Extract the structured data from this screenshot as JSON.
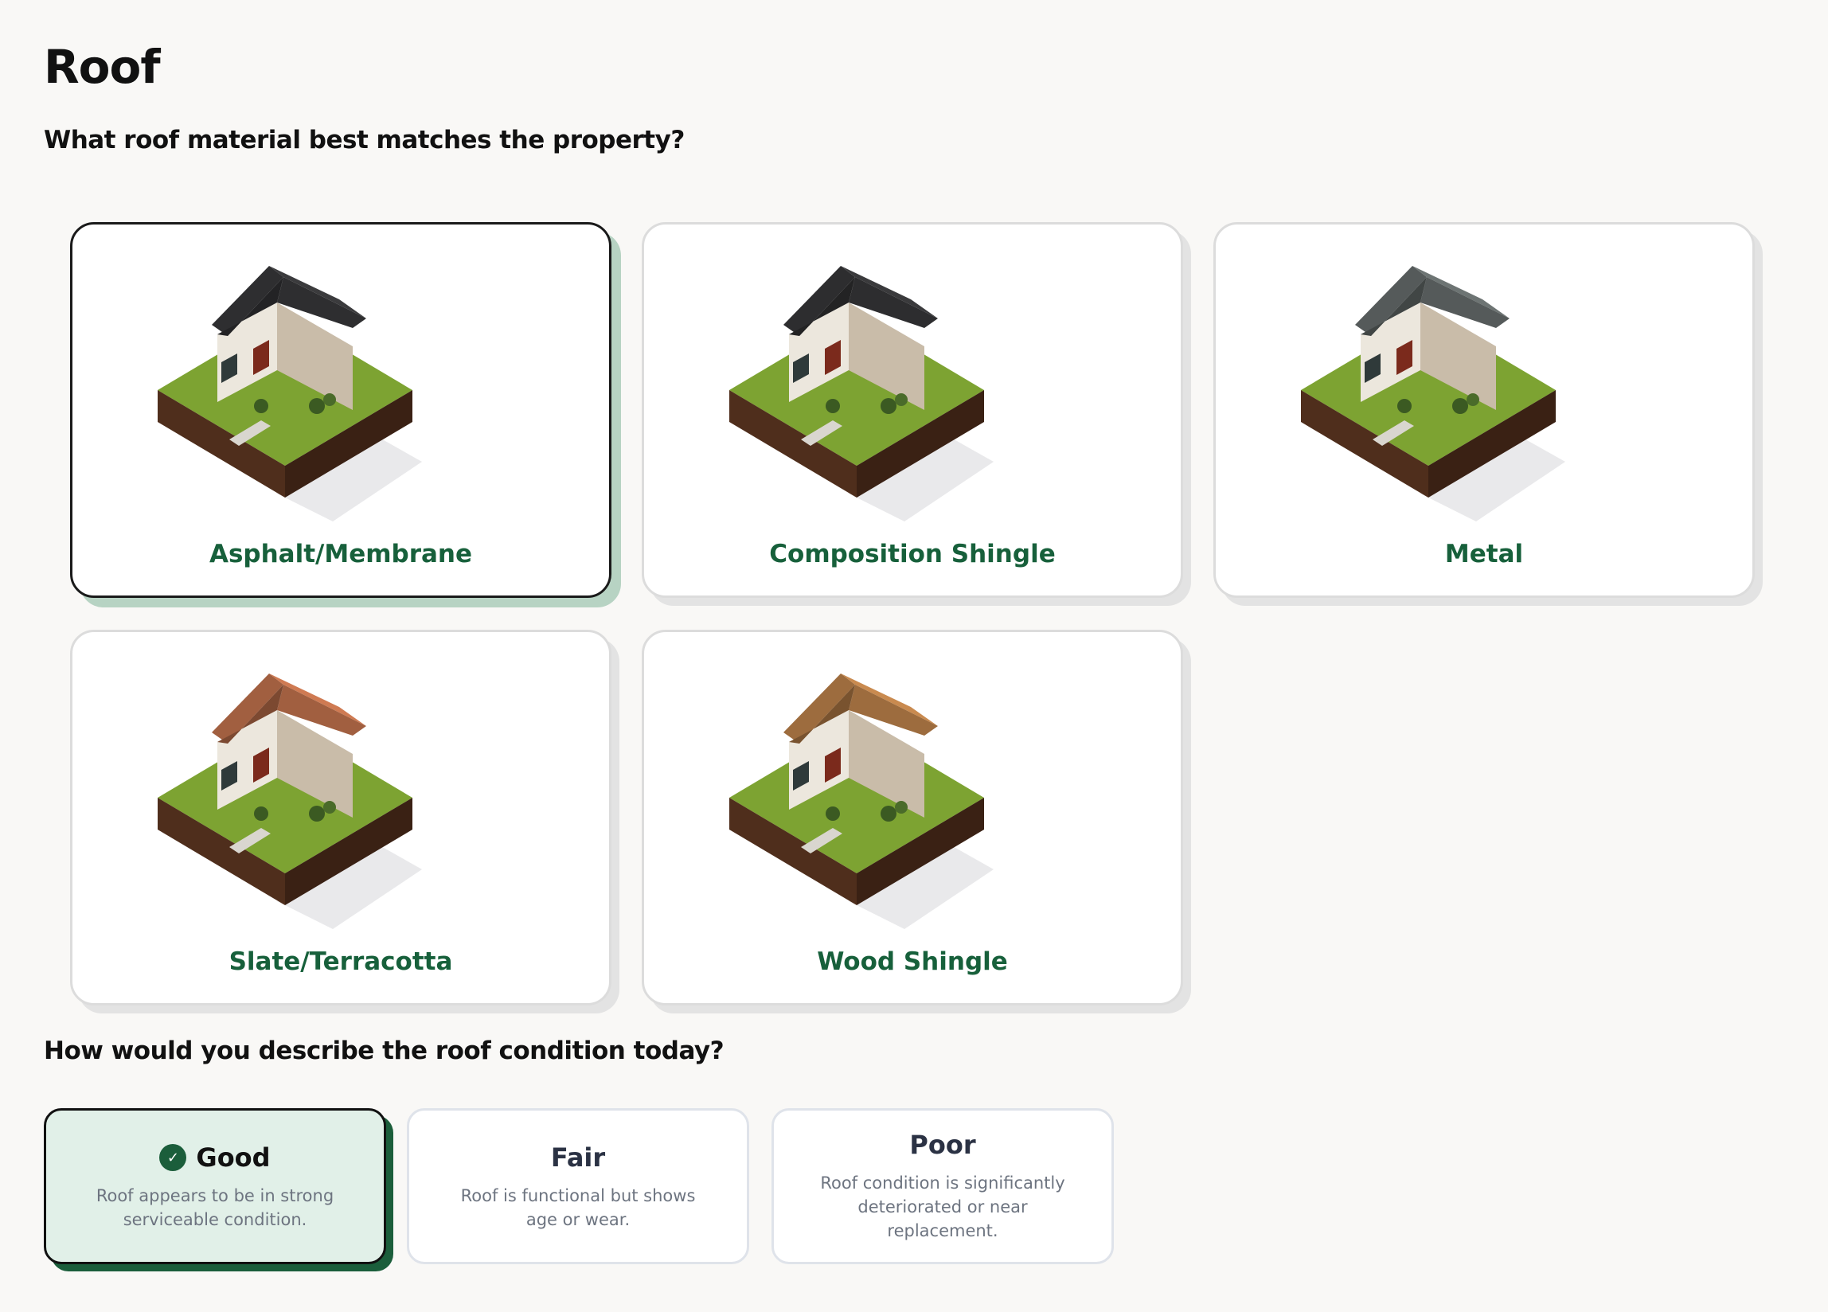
{
  "page": {
    "title": "Roof"
  },
  "material_question": "What roof material best matches the property?",
  "materials": [
    {
      "label": "Asphalt/Membrane",
      "roof_color": "#3b3b3d",
      "selected": true
    },
    {
      "label": "Composition Shingle",
      "roof_color": "#3a3a3c",
      "selected": false
    },
    {
      "label": "Metal",
      "roof_color": "#6d7473",
      "selected": false
    },
    {
      "label": "Slate/Terracotta",
      "roof_color": "#cf7a52",
      "selected": false
    },
    {
      "label": "Wood Shingle",
      "roof_color": "#c98a4f",
      "selected": false
    }
  ],
  "condition_question": "How would you describe the roof condition today?",
  "conditions": [
    {
      "title": "Good",
      "description": "Roof appears to be in strong serviceable condition.",
      "selected": true
    },
    {
      "title": "Fair",
      "description": "Roof is functional but shows age or wear.",
      "selected": false
    },
    {
      "title": "Poor",
      "description": "Roof condition is significantly deteriorated or near replacement.",
      "selected": false
    }
  ],
  "colors": {
    "accent_green": "#17603b",
    "selected_shadow": "#b7d3c3",
    "selected_condition_bg": "#e1f0e8"
  }
}
